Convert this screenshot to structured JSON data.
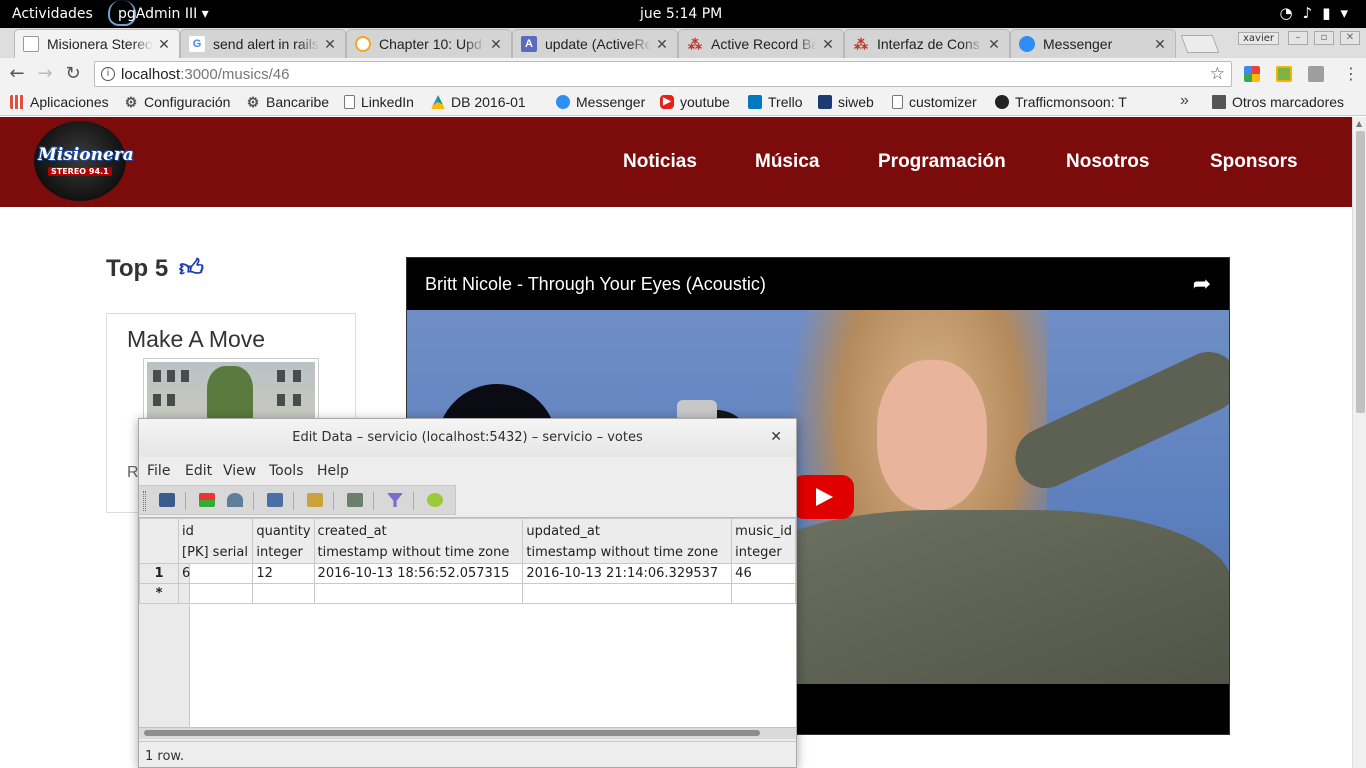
{
  "system_bar": {
    "activities": "Actividades",
    "app_name": "pgAdmin III",
    "clock": "jue  5:14 PM"
  },
  "tabs": [
    {
      "title": "Misionera Stereo",
      "color": "#9e9e9e",
      "glyph": ""
    },
    {
      "title": "send alert in rails",
      "color": "#4285f4",
      "glyph": "G"
    },
    {
      "title": "Chapter 10: Upd",
      "color": "#f5a623",
      "glyph": "O"
    },
    {
      "title": "update (ActiveRe",
      "color": "#5c6bc0",
      "glyph": "A"
    },
    {
      "title": "Active Record Bas",
      "color": "#c0392b",
      "glyph": "R"
    },
    {
      "title": "Interfaz de Cons",
      "color": "#c0392b",
      "glyph": "R"
    },
    {
      "title": "Messenger",
      "color": "#2f8ef5",
      "glyph": "m"
    }
  ],
  "profile_label": "xavier",
  "address": {
    "host": "localhost",
    "path": ":3000/musics/46"
  },
  "bookmarks": [
    {
      "label": "Aplicaciones",
      "color": "#e74c3c"
    },
    {
      "label": "Configuración",
      "color": "#555555"
    },
    {
      "label": "Bancaribe",
      "color": "#555555"
    },
    {
      "label": "LinkedIn",
      "color": "#777777"
    },
    {
      "label": "DB 2016-01",
      "color": "#0f9d58"
    },
    {
      "label": "Messenger",
      "color": "#2f8ef5"
    },
    {
      "label": "youtube",
      "color": "#e62117"
    },
    {
      "label": "Trello",
      "color": "#0079bf"
    },
    {
      "label": "siweb",
      "color": "#1a3b73"
    },
    {
      "label": "customizer",
      "color": "#777777"
    },
    {
      "label": "Trafficmonsoon: T",
      "color": "#222222"
    }
  ],
  "bookmarks_more": "»",
  "other_bookmarks": "Otros marcadores",
  "site": {
    "logo_text": "Misionera",
    "logo_sub": "STEREO 94.1",
    "nav": [
      "Noticias",
      "Música",
      "Programación",
      "Nosotros",
      "Sponsors"
    ],
    "top5_title": "Top 5",
    "card_title": "Make A Move",
    "card_footer": "R",
    "video_title": "Britt Nicole - Through Your Eyes (Acoustic)"
  },
  "dialog": {
    "title": "Edit Data – servicio (localhost:5432) – servicio – votes",
    "menu": [
      "File",
      "Edit",
      "View",
      "Tools",
      "Help"
    ],
    "columns": [
      {
        "name": "id",
        "type": "[PK] serial"
      },
      {
        "name": "quantity",
        "type": "integer"
      },
      {
        "name": "created_at",
        "type": "timestamp without time zone"
      },
      {
        "name": "updated_at",
        "type": "timestamp without time zone"
      },
      {
        "name": "music_id",
        "type": "integer"
      }
    ],
    "rows": [
      {
        "num": "1",
        "cells": [
          "6",
          "12",
          "2016-10-13 18:56:52.057315",
          "2016-10-13 21:14:06.329537",
          "46"
        ]
      }
    ],
    "new_row_marker": "*",
    "status": "1 row."
  },
  "colors": {
    "site_header": "#7c0b0b",
    "accent_blue": "#1d3fb5",
    "youtube_red": "#e10000"
  }
}
